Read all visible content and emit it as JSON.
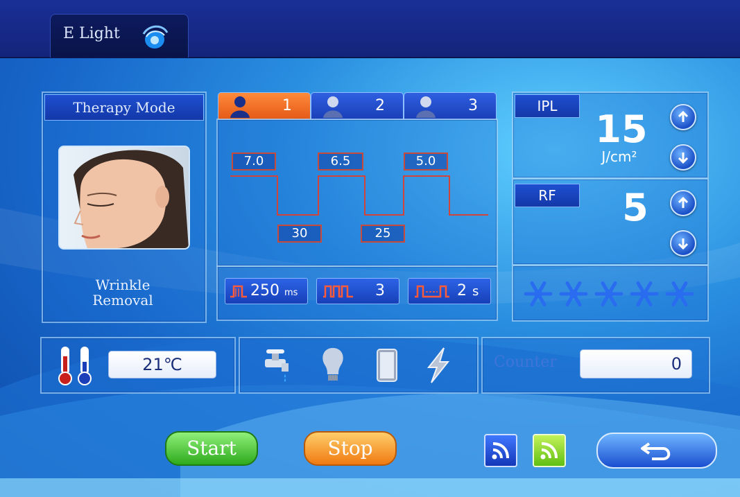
{
  "app": {
    "tab_title": "E Light"
  },
  "therapy": {
    "header": "Therapy Mode",
    "caption_line1": "Wrinkle",
    "caption_line2": "Removal"
  },
  "tabs": [
    {
      "label": "1",
      "active": true
    },
    {
      "label": "2",
      "active": false
    },
    {
      "label": "3",
      "active": false
    }
  ],
  "pulses": {
    "high_values": [
      "7.0",
      "6.5",
      "5.0"
    ],
    "low_values": [
      "30",
      "25"
    ]
  },
  "params": {
    "pulse_width_value": "250",
    "pulse_width_unit": "ms",
    "pulse_count": "3",
    "interval_value": "2",
    "interval_unit": "s"
  },
  "ipl": {
    "label": "IPL",
    "value": "15",
    "unit": "J/cm²"
  },
  "rf": {
    "label": "RF",
    "value": "5"
  },
  "cooling": {
    "icon": "snowflake-icon",
    "level": 5,
    "max": 5
  },
  "temperature": {
    "value": "21℃"
  },
  "status_icons": [
    "water-tap-icon",
    "lamp-icon",
    "tank-icon",
    "lightning-icon"
  ],
  "counter": {
    "label": "Counter",
    "value": "0"
  },
  "buttons": {
    "start": "Start",
    "stop": "Stop"
  },
  "colors": {
    "active_tab": "#f06a22",
    "pulse_line": "#d0443a",
    "start": "#3cbf2e",
    "stop": "#f08a20"
  }
}
